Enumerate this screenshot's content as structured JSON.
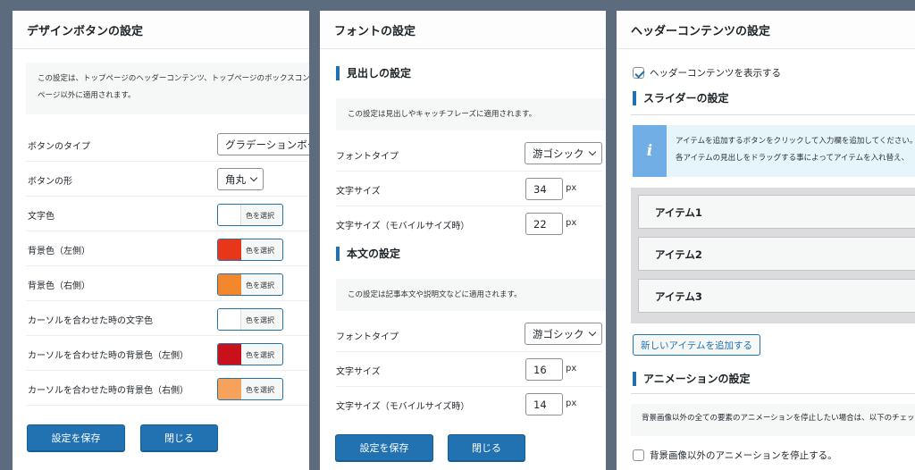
{
  "panel1": {
    "title": "デザインボタンの設定",
    "description": [
      "この設定は、トップページのヘッダーコンテンツ、トップページのボックスコンテンツ、",
      "ページ以外に適用されます。"
    ],
    "rows": [
      {
        "label": "ボタンのタイプ",
        "value": "グラデーションボタン"
      },
      {
        "label": "ボタンの形",
        "value": "角丸"
      },
      {
        "label": "文字色",
        "swatch": "#ffffff",
        "button": "色を選択"
      },
      {
        "label": "背景色（左側）",
        "swatch": "#e8361b",
        "button": "色を選択"
      },
      {
        "label": "背景色（右側）",
        "swatch": "#f2872c",
        "button": "色を選択"
      },
      {
        "label": "カーソルを合わせた時の文字色",
        "swatch": "#ffffff",
        "button": "色を選択"
      },
      {
        "label": "カーソルを合わせた時の背景色（左側）",
        "swatch": "#c8111b",
        "button": "色を選択"
      },
      {
        "label": "カーソルを合わせた時の背景色（右側）",
        "swatch": "#f6a25a",
        "button": "色を選択"
      }
    ],
    "save": "設定を保存",
    "close": "閉じる"
  },
  "panel2": {
    "title": "フォントの設定",
    "heading_section": {
      "title": "見出しの設定",
      "description": "この設定は見出しやキャッチフレーズに適用されます。",
      "font_type_label": "フォントタイプ",
      "font_type_value": "游ゴシック",
      "size_label": "文字サイズ",
      "size_value": "34",
      "mobile_label": "文字サイズ（モバイルサイズ時）",
      "mobile_value": "22",
      "unit": "px"
    },
    "body_section": {
      "title": "本文の設定",
      "description": "この設定は記事本文や説明文などに適用されます。",
      "font_type_label": "フォントタイプ",
      "font_type_value": "游ゴシック",
      "size_label": "文字サイズ",
      "size_value": "16",
      "mobile_label": "文字サイズ（モバイルサイズ時）",
      "mobile_value": "14",
      "unit": "px"
    },
    "save": "設定を保存",
    "close": "閉じる"
  },
  "panel3": {
    "title": "ヘッダーコンテンツの設定",
    "show_header_label": "ヘッダーコンテンツを表示する",
    "show_header_checked": true,
    "slider_title": "スライダーの設定",
    "info_lines": [
      "アイテムを追加するボタンをクリックして入力欄を追加してください。",
      "各アイテムの見出しをドラッグする事によってアイテムを入れ替え、"
    ],
    "items": [
      "アイテム1",
      "アイテム2",
      "アイテム3"
    ],
    "add_item": "新しいアイテムを追加する",
    "animation_title": "アニメーションの設定",
    "animation_description": "背景画像以外の全ての要素のアニメーションを停止したい場合は、以下のチェックボックスにチェックを入れてください。",
    "stop_animation_label": "背景画像以外のアニメーションを停止する。",
    "stop_animation_checked": false
  }
}
